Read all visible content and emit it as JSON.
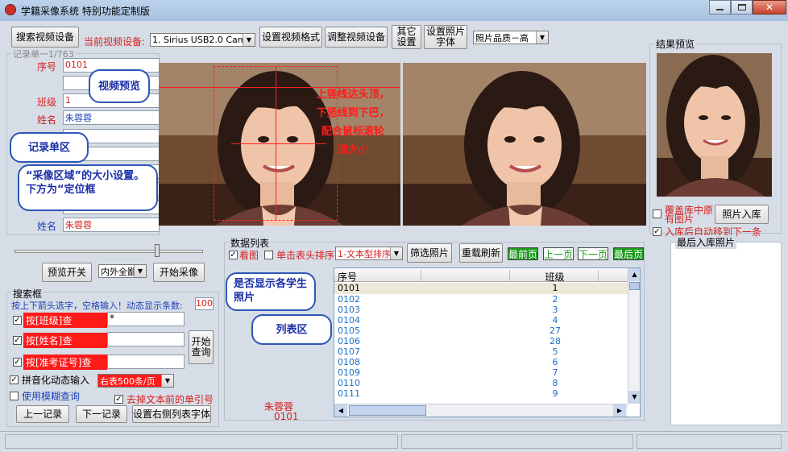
{
  "app": {
    "title": "学籍采像系统 特别功能定制版"
  },
  "toolbar": {
    "search_device": "搜索视频设备",
    "current_device_label": "当前视频设备:",
    "device_value": "1. Sirius USB2.0 Cam",
    "set_format": "设置视频格式",
    "adjust_device": "调整视频设备",
    "other_settings": "其它\n设置",
    "photo_font": "设置照片\n字体",
    "quality_value": "照片品质－高"
  },
  "record": {
    "title": "记录单一1/763",
    "fields": [
      {
        "label": "序号",
        "value": "0101"
      },
      {
        "label": "",
        "value": ""
      },
      {
        "label": "班级",
        "value": "1"
      },
      {
        "label": "姓名",
        "value": "朱蓉蓉"
      },
      {
        "label": "姓名",
        "value": "朱蓉蓉"
      }
    ]
  },
  "overlay": {
    "hint_text": "上竖线达头顶，\n下竖线到下巴，\n配合鼠标滚轮\n调大小"
  },
  "callouts": {
    "video_preview": "视频预览",
    "record_area": "记录单区",
    "capture_area": "“采像区域”的大小设置。下方为“定位框",
    "show_photo": "是否显示各学生照片",
    "list_area": "列表区"
  },
  "capture": {
    "preview_toggle": "预览开关",
    "mode_value": "内外全鄙",
    "start_capture": "开始采像"
  },
  "search": {
    "title": "搜索框",
    "hint": "按上下箭头选字，空格输入！动态显示条数:",
    "count_value": "100",
    "by_class": "按[班级]查",
    "by_class_value": "*",
    "by_name": "按[姓名]查",
    "by_exam_id": "按[准考证号]查",
    "start_query": "开始\n查询",
    "pinyin": "拼音化动态输入",
    "per_page_value": "右表500条/页",
    "fuzzy": "使用模糊查询",
    "remove_prefix": "去掉文本前的单引号",
    "prev_record": "上一记录",
    "next_record": "下一记录",
    "list_font": "设置右侧列表字体"
  },
  "current_student": {
    "name": "朱蓉蓉",
    "id": "0101"
  },
  "datalist": {
    "title": "数据列表",
    "view_photo": "看图",
    "click_sort": "单击表头排序",
    "sort_value": "1-文本型排序",
    "filter_photos": "筛选照片",
    "reload": "重载刷新",
    "first_page": "最前页",
    "prev_page": "上一页",
    "next_page": "下一页",
    "last_page": "最后页",
    "columns": [
      "序号",
      "",
      "班级",
      ""
    ],
    "rows": [
      {
        "id": "0101",
        "class": "1"
      },
      {
        "id": "0102",
        "class": "2"
      },
      {
        "id": "0103",
        "class": "3"
      },
      {
        "id": "0104",
        "class": "4"
      },
      {
        "id": "0105",
        "class": "27"
      },
      {
        "id": "0106",
        "class": "28"
      },
      {
        "id": "0107",
        "class": "5"
      },
      {
        "id": "0108",
        "class": "6"
      },
      {
        "id": "0109",
        "class": "7"
      },
      {
        "id": "0110",
        "class": "8"
      },
      {
        "id": "0111",
        "class": "9"
      }
    ]
  },
  "preview": {
    "title": "结果预览",
    "overwrite": "覆盖库中原有图片",
    "save_photo": "照片入库",
    "auto_next": "入库后自动移到下一条",
    "last_saved_title": "最后入库照片"
  }
}
